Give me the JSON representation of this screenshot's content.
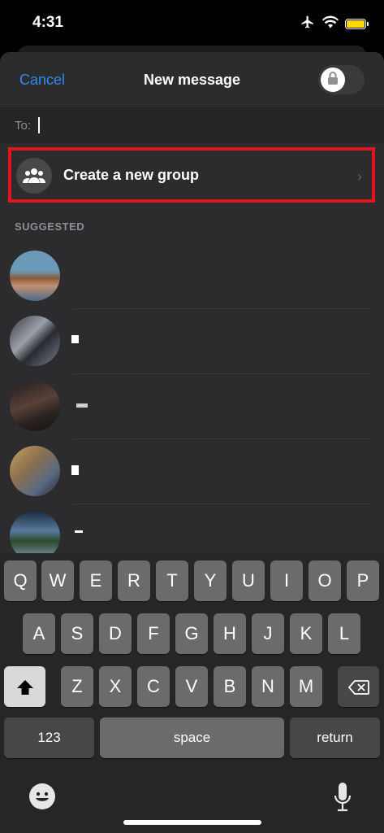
{
  "status_bar": {
    "time": "4:31"
  },
  "header": {
    "cancel_label": "Cancel",
    "title": "New message"
  },
  "to_field": {
    "label": "To:",
    "value": ""
  },
  "create_group": {
    "label": "Create a new group"
  },
  "section": {
    "suggested_label": "SUGGESTED"
  },
  "keyboard": {
    "row1": [
      "Q",
      "W",
      "E",
      "R",
      "T",
      "Y",
      "U",
      "I",
      "O",
      "P"
    ],
    "row2": [
      "A",
      "S",
      "D",
      "F",
      "G",
      "H",
      "J",
      "K",
      "L"
    ],
    "row3": [
      "Z",
      "X",
      "C",
      "V",
      "B",
      "N",
      "M"
    ],
    "numbers_label": "123",
    "space_label": "space",
    "return_label": "return"
  },
  "colors": {
    "accent": "#2f8bf0",
    "highlight_box": "#e3151a",
    "battery": "#ffd60a"
  }
}
